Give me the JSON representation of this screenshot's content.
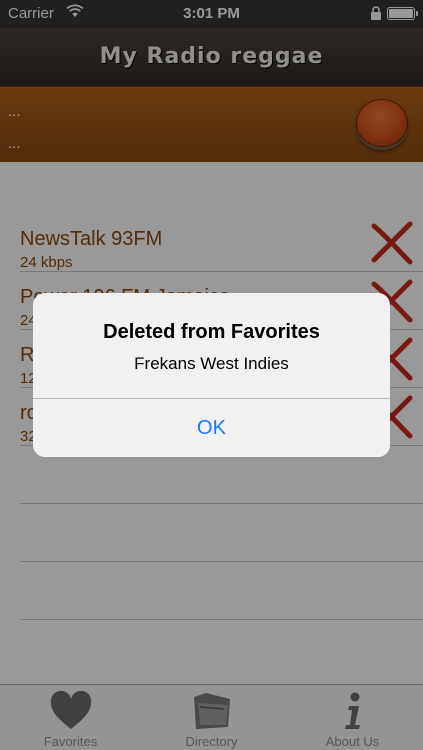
{
  "status_bar": {
    "carrier": "Carrier",
    "time": "3:01 PM"
  },
  "nav": {
    "title": "My Radio reggae"
  },
  "player": {
    "line1": "...",
    "line2": "..."
  },
  "favorites": [
    {
      "name": "NewsTalk 93FM",
      "bitrate": "24 kbps"
    },
    {
      "name": "Power 106 FM Jamaica",
      "bitrate": "24 kbps"
    },
    {
      "name": "Radio",
      "bitrate": "128 kbps"
    },
    {
      "name": "ro",
      "bitrate": "32 kbps"
    }
  ],
  "tabs": [
    {
      "label": "Favorites",
      "icon": "heart-icon"
    },
    {
      "label": "Directory",
      "icon": "folder-icon"
    },
    {
      "label": "About Us",
      "icon": "info-icon"
    }
  ],
  "alert": {
    "title": "Deleted from Favorites",
    "message": "Frekans West Indies",
    "button": "OK"
  },
  "colors": {
    "accent": "#1a7cf5",
    "station_text": "#8b4a10",
    "player_bg": "#a35a18"
  }
}
